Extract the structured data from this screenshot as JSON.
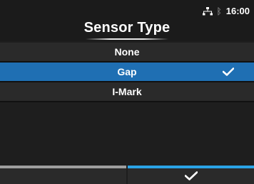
{
  "header": {
    "title": "Sensor Type",
    "time": "16:00",
    "icons": [
      "network-icon",
      "bluetooth-icon"
    ]
  },
  "list": {
    "items": [
      {
        "label": "None",
        "selected": false
      },
      {
        "label": "Gap",
        "selected": true
      },
      {
        "label": "I-Mark",
        "selected": false
      }
    ]
  },
  "footer": {
    "ok_icon": "checkmark-icon"
  },
  "colors": {
    "background": "#1e1e1e",
    "selected": "#1f6fb3",
    "footer_accent": "#2aa3e6"
  }
}
